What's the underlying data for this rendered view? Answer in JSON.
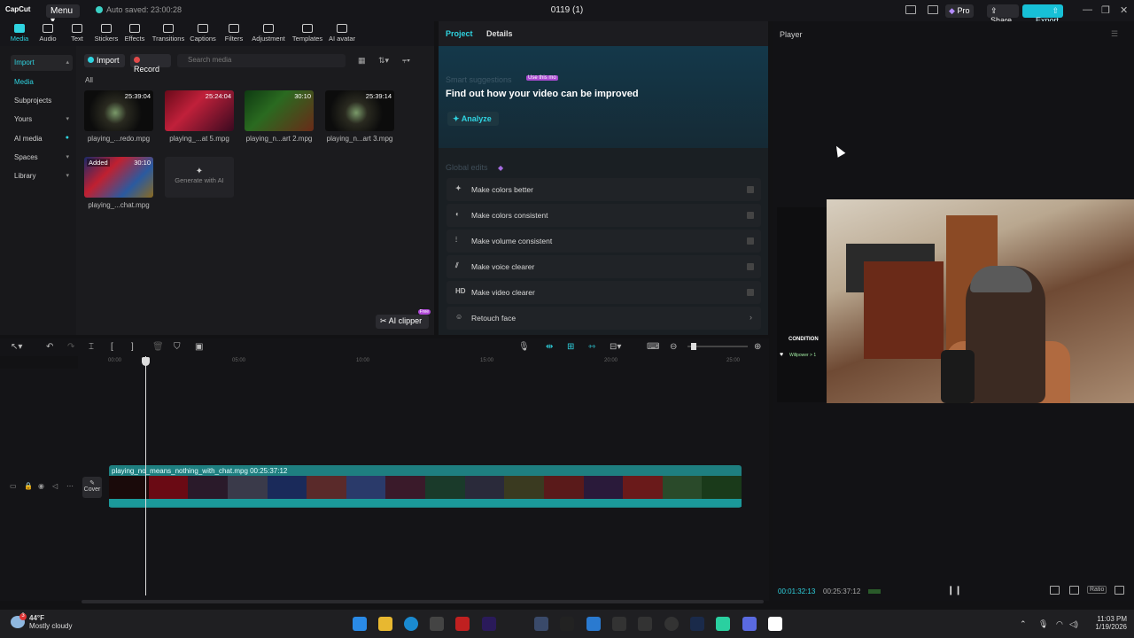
{
  "app": {
    "logo": "CapCut",
    "menu_label": "Menu",
    "autosave": "Auto saved: 23:00:28",
    "doc_title": "0119 (1)",
    "pro_label": "Pro",
    "share_label": "Share",
    "export_label": "Export",
    "win_minimize": "—",
    "win_maximize": "❐",
    "win_close": "✕"
  },
  "toolbar": [
    {
      "label": "Media",
      "icon": "media-icon"
    },
    {
      "label": "Audio",
      "icon": "audio-icon"
    },
    {
      "label": "Text",
      "icon": "text-icon"
    },
    {
      "label": "Stickers",
      "icon": "sticker-icon"
    },
    {
      "label": "Effects",
      "icon": "effects-icon"
    },
    {
      "label": "Transitions",
      "icon": "transition-icon"
    },
    {
      "label": "Captions",
      "icon": "captions-icon"
    },
    {
      "label": "Filters",
      "icon": "filters-icon"
    },
    {
      "label": "Adjustment",
      "icon": "adjustment-icon"
    },
    {
      "label": "Templates",
      "icon": "templates-icon"
    },
    {
      "label": "AI avatar",
      "icon": "ai-avatar-icon"
    }
  ],
  "sidebar": {
    "items": [
      {
        "label": "Import",
        "chev": "▴"
      },
      {
        "label": "Media",
        "chev": ""
      },
      {
        "label": "Subprojects",
        "chev": ""
      },
      {
        "label": "Yours",
        "chev": "▾"
      },
      {
        "label": "AI media",
        "chev": ""
      },
      {
        "label": "Spaces",
        "chev": "▾"
      },
      {
        "label": "Library",
        "chev": "▾"
      }
    ]
  },
  "media": {
    "import_label": "Import",
    "record_label": "Record",
    "search_placeholder": "Search media",
    "all_label": "All",
    "thumbs": [
      {
        "name": "playing_...redo.mpg",
        "duration": "25:39:04",
        "added": ""
      },
      {
        "name": "playing_...at 5.mpg",
        "duration": "25:24:04",
        "added": ""
      },
      {
        "name": "playing_n...art 2.mpg",
        "duration": "30:10",
        "added": ""
      },
      {
        "name": "playing_n...art 3.mpg",
        "duration": "25:39:14",
        "added": ""
      },
      {
        "name": "playing_...chat.mpg",
        "duration": "30:10",
        "added": "Added"
      }
    ],
    "generate_label": "Generate with AI",
    "ai_clipper_label": "AI clipper",
    "ai_clipper_badge": "Free"
  },
  "project": {
    "tabs": [
      "Project",
      "Details"
    ],
    "suggestions_title": "Smart suggestions",
    "suggestions_badge": "Use this mo",
    "headline": "Find out how your video can be improved",
    "analyze_label": "Analyze",
    "global_edits_label": "Global edits",
    "edits": [
      {
        "icon": "✦",
        "label": "Make colors better"
      },
      {
        "icon": "◐",
        "label": "Make colors consistent"
      },
      {
        "icon": "⫶",
        "label": "Make volume consistent"
      },
      {
        "icon": "⫽",
        "label": "Make voice clearer"
      },
      {
        "icon": "HD",
        "label": "Make video clearer"
      },
      {
        "icon": "☺",
        "label": "Retouch face"
      }
    ]
  },
  "player": {
    "label": "Player",
    "overlay_condition": "CONDITION",
    "overlay_willpower": "Willpower > 1",
    "time_current": "00:01:32:13",
    "time_total": "00:25:37:12",
    "ratio_label": "Ratio",
    "pause_icon": "❙❙"
  },
  "timeline": {
    "ruler_ticks": [
      "00:00",
      "05:00",
      "10:00",
      "15:00",
      "20:00",
      "25:00"
    ],
    "clip_label": "playing_no_means_nothing_with_chat.mpg  00:25:37:12",
    "cover_label": "Cover",
    "cover_icon": "✎"
  },
  "taskbar": {
    "temp": "44°F",
    "weather": "Mostly cloudy",
    "weather_badge": "3",
    "time": "11:03 PM",
    "date": "1/19/2026"
  }
}
